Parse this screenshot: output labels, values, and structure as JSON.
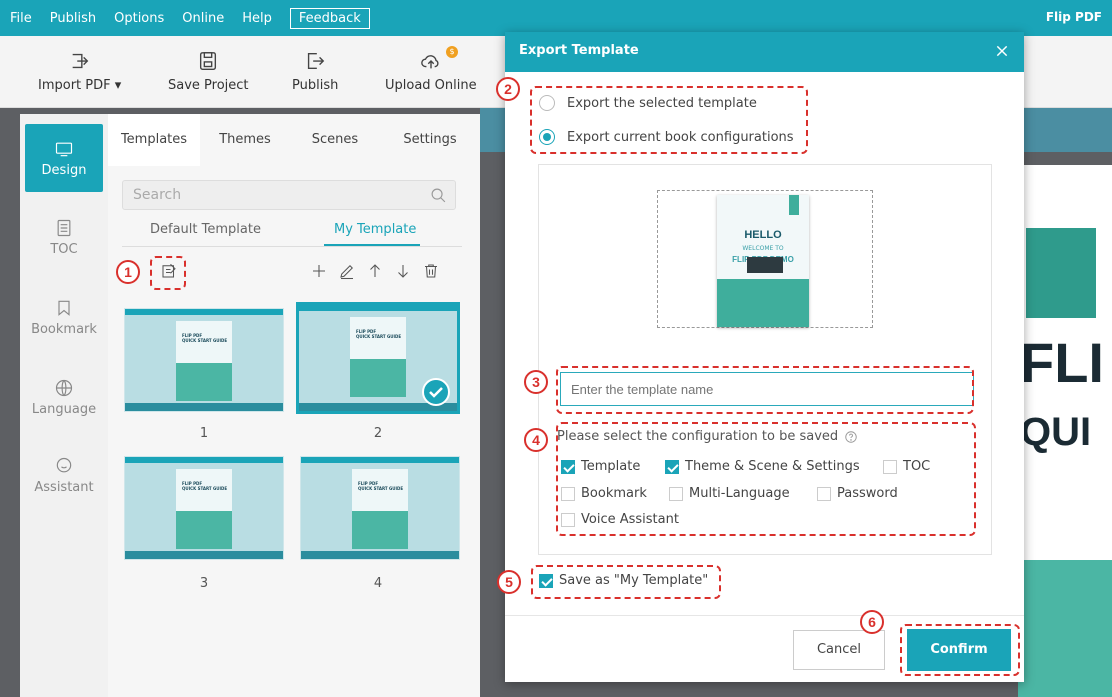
{
  "menubar": {
    "items": [
      "File",
      "Publish",
      "Options",
      "Online",
      "Help"
    ],
    "feedback": "Feedback",
    "brand": "Flip PDF",
    "accent": "#1aa4b8"
  },
  "toolbar": {
    "import_pdf": "Import PDF ▾",
    "save_project": "Save Project",
    "publish": "Publish",
    "upload_online": "Upload Online",
    "upload_badge": "$"
  },
  "leftnav": {
    "design": "Design",
    "toc": "TOC",
    "bookmark": "Bookmark",
    "language": "Language",
    "assistant": "Assistant"
  },
  "panel": {
    "tabs": [
      "Templates",
      "Themes",
      "Scenes",
      "Settings"
    ],
    "search_placeholder": "Search",
    "subtabs": [
      "Default Template",
      "My Template"
    ],
    "thumb_labels": [
      "1",
      "2",
      "3",
      "4"
    ],
    "thumb_cover_text": "FLIP PDF\nQUICK START GUIDE"
  },
  "document": {
    "text1": "FLI",
    "text2": "QUI"
  },
  "dialog": {
    "title": "Export Template",
    "radio_selected_template": "Export the selected template",
    "radio_current_book": "Export current book configurations",
    "book_hello": "HELLO",
    "book_welcome": "WELCOME TO",
    "book_flip": "FLIP PDF DEMO",
    "name_placeholder": "Enter the template name",
    "config_title": "Please select the configuration to be saved",
    "options": {
      "template": "Template",
      "theme_scene_settings": "Theme & Scene & Settings",
      "toc": "TOC",
      "bookmark": "Bookmark",
      "multi_language": "Multi-Language",
      "password": "Password",
      "voice_assistant": "Voice Assistant"
    },
    "save_as_my_template": "Save as \"My Template\"",
    "cancel": "Cancel",
    "confirm": "Confirm"
  },
  "annotations": [
    "1",
    "2",
    "3",
    "4",
    "5",
    "6"
  ]
}
